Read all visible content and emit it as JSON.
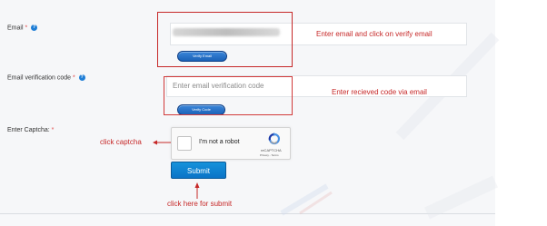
{
  "form": {
    "email_label": "Email",
    "required_marker": "*",
    "verify_email_button": "Verify Email",
    "code_label": "Email verification code",
    "code_placeholder": "Enter email verification code",
    "verify_code_button": "Verify Code",
    "captcha_label": "Enter Captcha:",
    "submit_button": "Submit"
  },
  "captcha": {
    "checkbox_label": "I'm not a robot",
    "brand": "reCAPTCHA",
    "terms": "Privacy - Terms"
  },
  "annotations": {
    "email": "Enter email and click on verify email",
    "code": "Enter recieved code via email",
    "captcha": "click captcha",
    "submit": "click here for submit"
  },
  "icons": {
    "help": "question-circle-icon"
  },
  "colors": {
    "annotation_red": "#c62828",
    "button_blue": "#0b74c7",
    "required_red": "#e24b4b"
  }
}
